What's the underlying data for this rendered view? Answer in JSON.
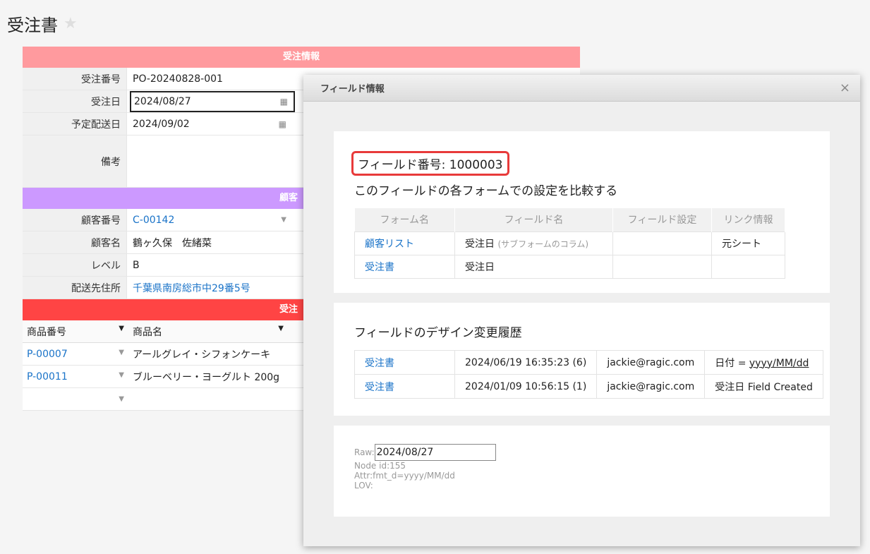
{
  "page": {
    "title": "受注書"
  },
  "form": {
    "section_info": "受注情報",
    "order_no": {
      "label": "受注番号",
      "value": "PO-20240828-001"
    },
    "order_date": {
      "label": "受注日",
      "value": "2024/08/27"
    },
    "ship_date": {
      "label": "予定配送日",
      "value": "2024/09/02"
    },
    "memo": {
      "label": "備考",
      "value": ""
    },
    "section_customer": "顧客",
    "customer_no": {
      "label": "顧客番号",
      "value": "C-00142"
    },
    "customer_name": {
      "label": "顧客名",
      "value": "鶴ヶ久保　佐緒菜"
    },
    "level": {
      "label": "レベル",
      "value": "B"
    },
    "address": {
      "label": "配送先住所",
      "value": "千葉県南房総市中29番5号"
    },
    "section_items": "受注",
    "items_headers": [
      "商品番号",
      "商品名"
    ],
    "items": [
      {
        "code": "P-00007",
        "name": "アールグレイ・シフォンケーキ"
      },
      {
        "code": "P-00011",
        "name": "ブルーベリー・ヨーグルト 200g"
      }
    ]
  },
  "dialog": {
    "title": "フィールド情報",
    "field_number": "フィールド番号: 1000003",
    "compare_title": "このフィールドの各フォームでの設定を比較する",
    "compare_headers": [
      "フォーム名",
      "フィールド名",
      "フィールド設定",
      "リンク情報"
    ],
    "compare_rows": [
      {
        "form": "顧客リスト",
        "field": "受注日",
        "field_note": "(サブフォームのコラム)",
        "setting": "",
        "link": "元シート"
      },
      {
        "form": "受注書",
        "field": "受注日",
        "field_note": "",
        "setting": "",
        "link": ""
      }
    ],
    "history_title": "フィールドのデザイン変更履歴",
    "history_rows": [
      {
        "form": "受注書",
        "time": "2024/06/19 16:35:23 (6)",
        "user": "jackie@ragic.com",
        "change_prefix": "日付 = ",
        "change_value": "yyyy/MM/dd"
      },
      {
        "form": "受注書",
        "time": "2024/01/09 10:56:15 (1)",
        "user": "jackie@ragic.com",
        "change_prefix": "受注日 Field Created",
        "change_value": ""
      }
    ],
    "raw_label": "Raw:",
    "raw_value": "2024/08/27",
    "node_id": "Node id:155",
    "attr": "Attr:fmt_d=yyyy/MM/dd",
    "lov": "LOV:"
  }
}
